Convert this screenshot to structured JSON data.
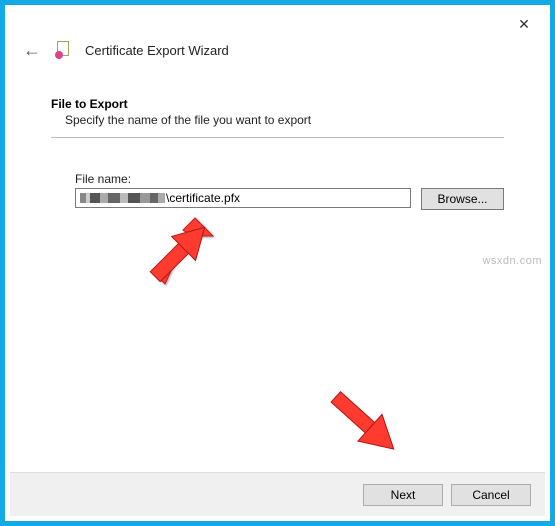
{
  "header": {
    "title": "Certificate Export Wizard"
  },
  "section": {
    "title": "File to Export",
    "subtitle": "Specify the name of the file you want to export"
  },
  "field": {
    "label": "File name:",
    "value_visible_suffix": "\\certificate.pfx",
    "browse_label": "Browse..."
  },
  "footer": {
    "next_label": "Next",
    "cancel_label": "Cancel"
  },
  "watermark": "wsxdn.com"
}
